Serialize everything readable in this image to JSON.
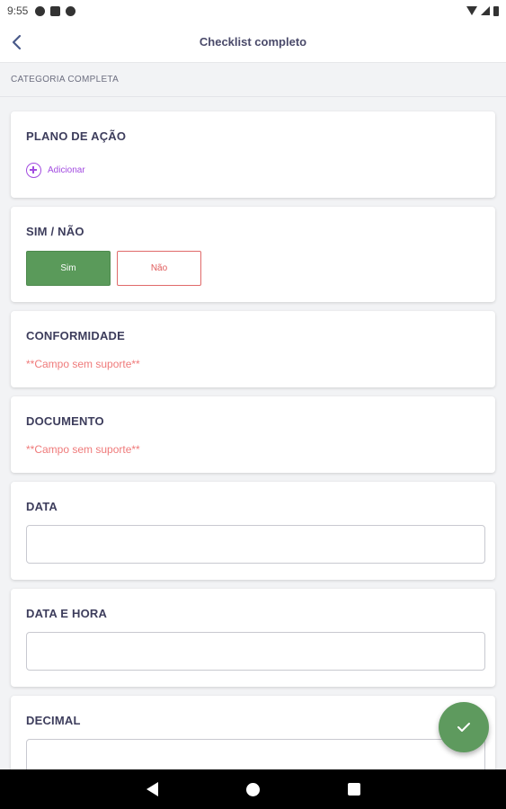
{
  "status_bar": {
    "time": "9:55",
    "left_icons": [
      "app-icon-a",
      "sim-card-icon",
      "no-sign-icon"
    ],
    "right_icons": [
      "wifi-icon",
      "signal-icon",
      "battery-icon"
    ]
  },
  "app_bar": {
    "title": "Checklist completo",
    "back_icon": "chevron-left-icon"
  },
  "category": {
    "label": "CATEGORIA COMPLETA"
  },
  "cards": {
    "plano_de_acao": {
      "title": "PLANO DE AÇÃO",
      "add_label": "Adicionar",
      "add_icon": "plus-circle-icon"
    },
    "sim_nao": {
      "title": "SIM / NÃO",
      "yes_label": "Sim",
      "no_label": "Não",
      "selected": "Sim"
    },
    "conformidade": {
      "title": "CONFORMIDADE",
      "message": "**Campo sem suporte**"
    },
    "documento": {
      "title": "DOCUMENTO",
      "message": "**Campo sem suporte**"
    },
    "data": {
      "title": "DATA",
      "value": ""
    },
    "data_e_hora": {
      "title": "DATA E HORA",
      "value": ""
    },
    "decimal": {
      "title": "DECIMAL",
      "value": ""
    }
  },
  "fab": {
    "icon": "check-icon"
  },
  "colors": {
    "accent_purple": "#a24be0",
    "yes_green": "#5a9a5a",
    "no_red": "#e05a5a",
    "unsupported_text": "#ef7a7a",
    "fab_green": "#5e9a5e"
  },
  "nav_bar": {
    "icons": [
      "nav-back-icon",
      "nav-home-icon",
      "nav-recent-apps-icon"
    ]
  }
}
